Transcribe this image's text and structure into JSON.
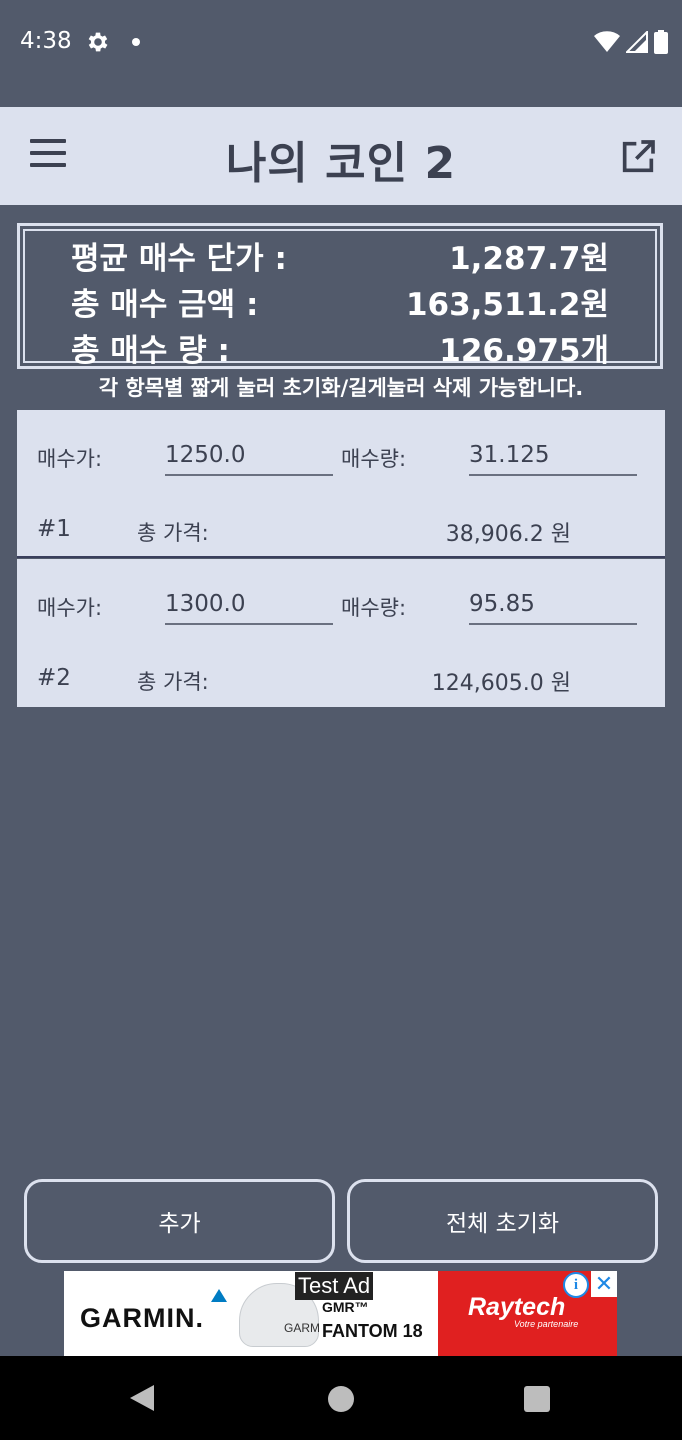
{
  "status": {
    "time": "4:38"
  },
  "app": {
    "title": "나의 코인 2"
  },
  "summary": {
    "avg_label": "평균 매수 단가 :",
    "avg_value": "1,287.7원",
    "total_label": "총 매수 금액 :",
    "total_value": "163,511.2원",
    "qty_label": "총 매수 량 :",
    "qty_value": "126.975개"
  },
  "hint": "각 항목별 짧게 눌러 초기화/길게눌러 삭제 가능합니다.",
  "entries": [
    {
      "price_label": "매수가:",
      "price": "1250.0",
      "qty_label": "매수량:",
      "qty": "31.125",
      "index": "#1",
      "total_label": "총 가격:",
      "total": "38,906.2 원"
    },
    {
      "price_label": "매수가:",
      "price": "1300.0",
      "qty_label": "매수량:",
      "qty": "95.85",
      "index": "#2",
      "total_label": "총 가격:",
      "total": "124,605.0 원"
    }
  ],
  "buttons": {
    "add": "추가",
    "reset_all": "전체 초기화"
  },
  "ad": {
    "label": "Test Ad",
    "garmin": "GARMIN.",
    "dome_text": "GARM",
    "gmr": "GMR™",
    "fantom": "FANTOM 18",
    "raytech": "Raytech",
    "partner": "Votre partenaire",
    "info": "i",
    "close": "✕"
  }
}
